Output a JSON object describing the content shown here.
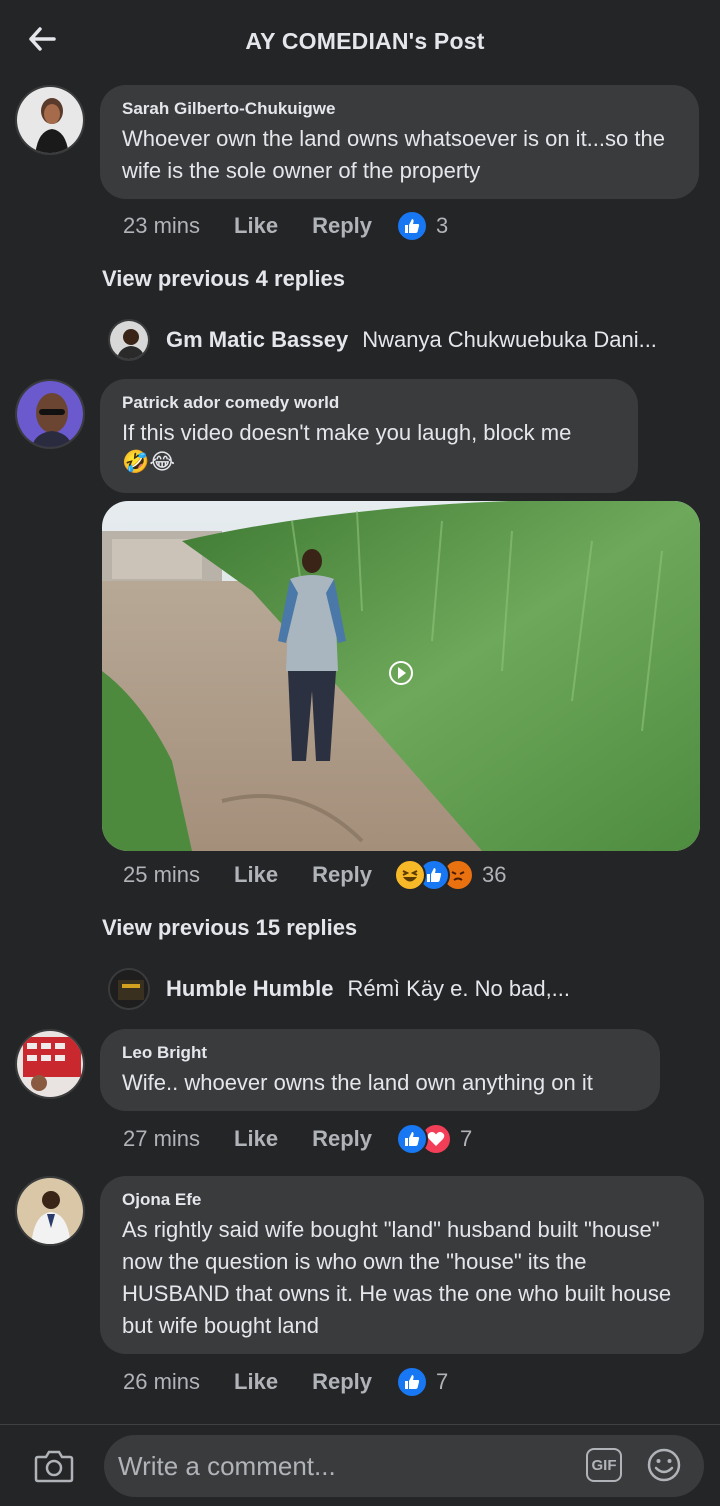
{
  "header": {
    "title": "AY COMEDIAN's Post",
    "back_icon": "arrow-left-icon"
  },
  "comments": [
    {
      "author": "Sarah Gilberto-Chukuigwe",
      "text": "Whoever own the land owns whatsoever is on it...so the wife is the sole owner of the property",
      "time": "23 mins",
      "like": "Like",
      "reply": "Reply",
      "reactions": [
        "like"
      ],
      "reaction_count": "3"
    },
    {
      "author": "Patrick ador comedy world",
      "text": "If this video doesn't make you laugh, block me",
      "emoji": "🤣😂",
      "time": "25 mins",
      "like": "Like",
      "reply": "Reply",
      "reactions": [
        "haha",
        "like",
        "angry"
      ],
      "reaction_count": "36"
    },
    {
      "author": "Leo Bright",
      "text": "Wife.. whoever owns the land own anything on it",
      "time": "27 mins",
      "like": "Like",
      "reply": "Reply",
      "reactions": [
        "like",
        "love"
      ],
      "reaction_count": "7"
    },
    {
      "author": "Ojona Efe",
      "text": "As rightly said wife bought \"land\" husband built \"house\" now the question is who own the \"house\" its the HUSBAND that owns it. He was the one who built house but wife bought land",
      "time": "26 mins",
      "like": "Like",
      "reply": "Reply",
      "reactions": [
        "like"
      ],
      "reaction_count": "7"
    }
  ],
  "thread1": {
    "view_replies": "View previous 4 replies",
    "preview_name": "Gm Matic Bassey",
    "preview_text": "Nwanya Chukwuebuka Dani..."
  },
  "thread2": {
    "view_replies": "View previous 15 replies",
    "preview_name": "Humble Humble",
    "preview_text": "Rémì Käy e. No bad,..."
  },
  "composer": {
    "placeholder": "Write a comment...",
    "gif_label": "GIF",
    "camera_icon": "camera-icon",
    "emoji_icon": "smiley-icon"
  },
  "colors": {
    "background": "#242526",
    "bubble": "#3a3b3c",
    "text": "#e4e6eb",
    "muted": "#b0b3b8",
    "like_blue": "#1877f2"
  }
}
